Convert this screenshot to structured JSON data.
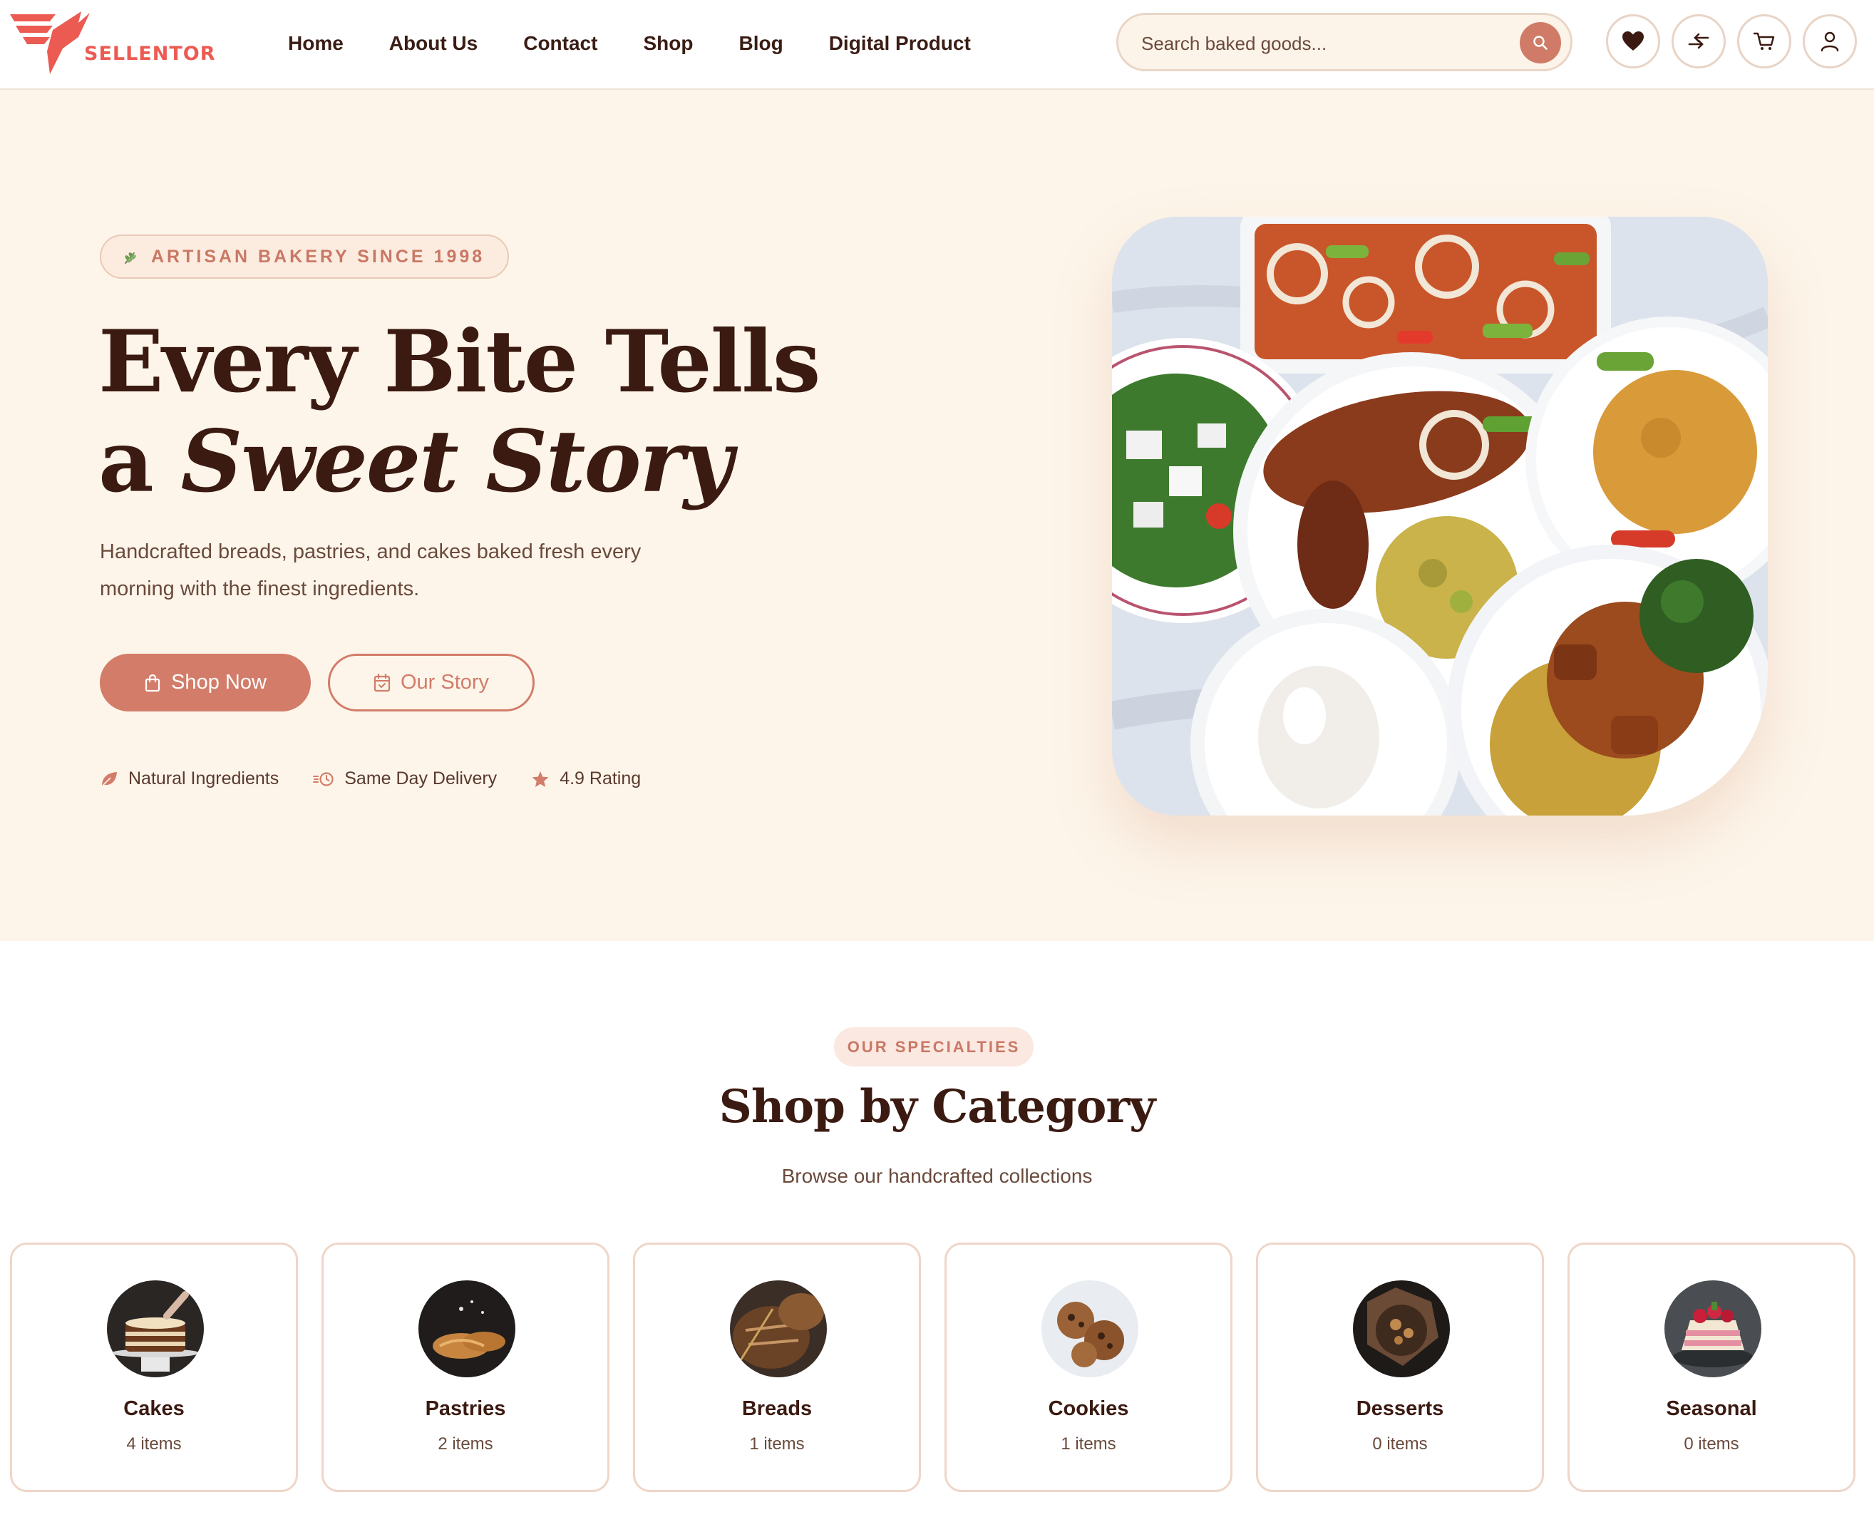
{
  "brand": {
    "name": "SELLENTOR",
    "logo_color": "#ec5b52"
  },
  "nav": {
    "items": [
      "Home",
      "About Us",
      "Contact",
      "Shop",
      "Blog",
      "Digital Product"
    ]
  },
  "search": {
    "placeholder": "Search baked goods...",
    "icon": "search-icon"
  },
  "header_icons": [
    "heart-icon",
    "compare-icon",
    "cart-icon",
    "user-icon"
  ],
  "hero": {
    "badge": "ARTISAN BAKERY SINCE 1998",
    "title_line1": "Every Bite Tells",
    "title_line2_prefix": "a ",
    "title_line2_accent": "Sweet Story",
    "description": "Handcrafted breads, pastries, and cakes baked fresh every morning with the finest ingredients.",
    "primary_button": "Shop Now",
    "secondary_button": "Our Story",
    "features": [
      {
        "label": "Natural Ingredients",
        "icon": "leaf-icon"
      },
      {
        "label": "Same Day Delivery",
        "icon": "fast-clock-icon"
      },
      {
        "label": "4.9 Rating",
        "icon": "star-icon"
      }
    ],
    "image": "food-platter-image"
  },
  "categories": {
    "pill": "OUR SPECIALTIES",
    "title": "Shop by Category",
    "subtitle": "Browse our handcrafted collections",
    "items": [
      {
        "name": "Cakes",
        "count": "4 items"
      },
      {
        "name": "Pastries",
        "count": "2 items"
      },
      {
        "name": "Breads",
        "count": "1 items"
      },
      {
        "name": "Cookies",
        "count": "1 items"
      },
      {
        "name": "Desserts",
        "count": "0 items"
      },
      {
        "name": "Seasonal",
        "count": "0 items"
      }
    ]
  },
  "colors": {
    "accent": "#d27c69",
    "hero_bg": "#fdf5ea",
    "text_dark": "#3b1a11"
  }
}
